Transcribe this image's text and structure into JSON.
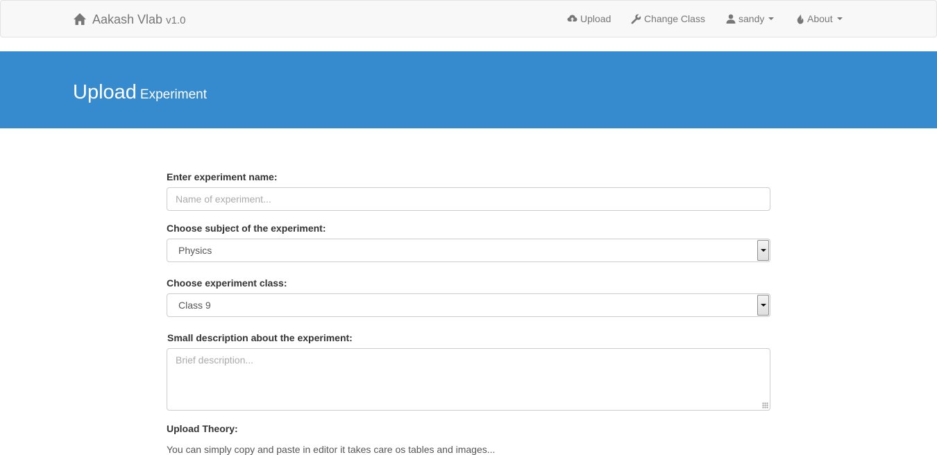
{
  "navbar": {
    "brand_name": "Aakash Vlab",
    "brand_version": "v1.0",
    "items": {
      "upload": "Upload",
      "change_class": "Change Class",
      "user": "sandy",
      "about": "About"
    }
  },
  "hero": {
    "title": "Upload",
    "subtitle": "Experiment"
  },
  "form": {
    "name_label": "Enter experiment name:",
    "name_placeholder": "Name of experiment...",
    "subject_label": "Choose subject of the experiment:",
    "subject_value": "Physics",
    "class_label": "Choose experiment class:",
    "class_value": "Class 9",
    "description_label": "Small description about the experiment:",
    "description_placeholder": "Brief description...",
    "theory_label": "Upload Theory:",
    "theory_help": "You can simply copy and paste in editor it takes care os tables and images..."
  },
  "colors": {
    "hero_bg": "#368bcf",
    "navbar_bg": "#f8f8f8",
    "nav_text": "#777777"
  }
}
